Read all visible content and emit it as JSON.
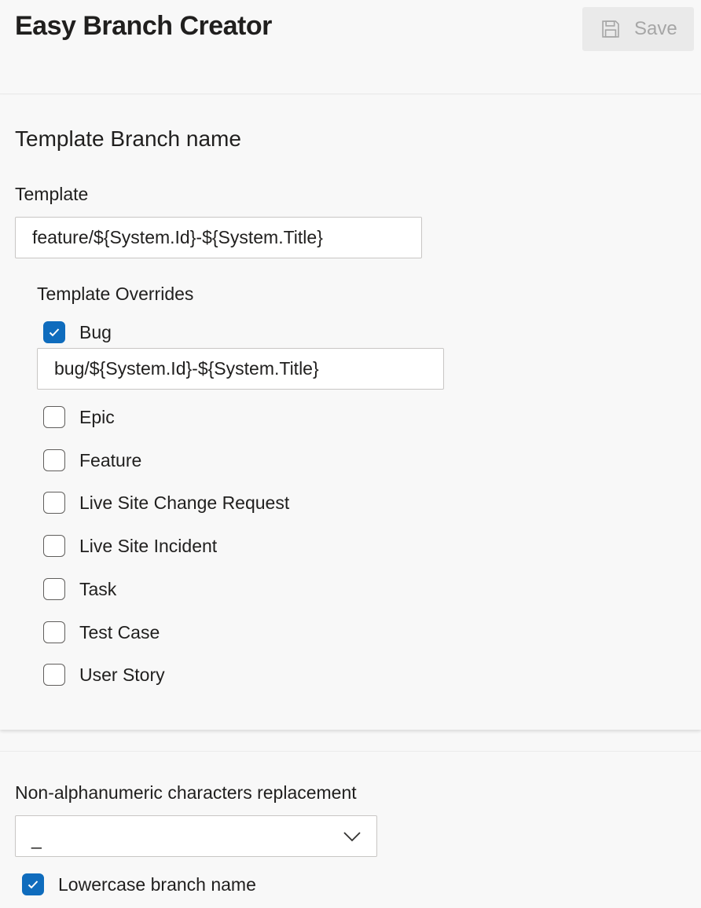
{
  "header": {
    "title": "Easy Branch Creator",
    "save_label": "Save",
    "save_icon": "floppy-disk-icon"
  },
  "template_section": {
    "title": "Template Branch name",
    "template_label": "Template",
    "template_value": "feature/${System.Id}-${System.Title}",
    "overrides_label": "Template Overrides",
    "overrides": [
      {
        "label": "Bug",
        "checked": true
      },
      {
        "label": "Epic",
        "checked": false
      },
      {
        "label": "Feature",
        "checked": false
      },
      {
        "label": "Live Site Change Request",
        "checked": false
      },
      {
        "label": "Live Site Incident",
        "checked": false
      },
      {
        "label": "Task",
        "checked": false
      },
      {
        "label": "Test Case",
        "checked": false
      },
      {
        "label": "User Story",
        "checked": false
      }
    ],
    "bug_template_value": "bug/${System.Id}-${System.Title}"
  },
  "replacement_section": {
    "label": "Non-alphanumeric characters replacement",
    "selected": "_",
    "lowercase_label": "Lowercase branch name",
    "lowercase_checked": true
  },
  "colors": {
    "accent": "#0f6cbd",
    "disabled_text": "#a6a6a6",
    "disabled_bg": "#eaeaea"
  }
}
